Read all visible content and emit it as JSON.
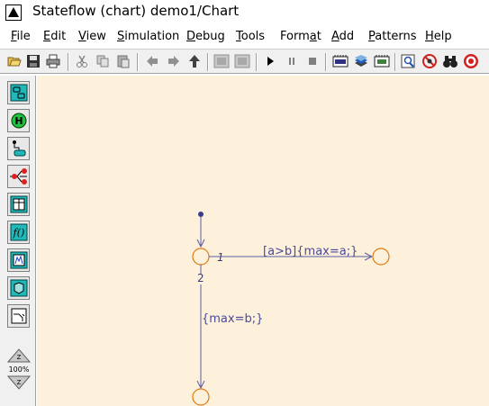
{
  "window": {
    "title": "Stateflow (chart) demo1/Chart"
  },
  "menu": {
    "file": "File",
    "edit": "Edit",
    "view": "View",
    "simulation": "Simulation",
    "debug": "Debug",
    "tools": "Tools",
    "format": "Format",
    "add": "Add",
    "patterns": "Patterns",
    "help": "Help"
  },
  "palette": {
    "zoom_level": "100%"
  },
  "chart": {
    "transition1": {
      "order": "1",
      "label": "[a>b]{max=a;}"
    },
    "transition2": {
      "order": "2",
      "label": "{max=b;}"
    }
  },
  "colors": {
    "canvas": "#fdf1dc",
    "junction": "#e07a10",
    "transition": "#5a5aa0"
  }
}
